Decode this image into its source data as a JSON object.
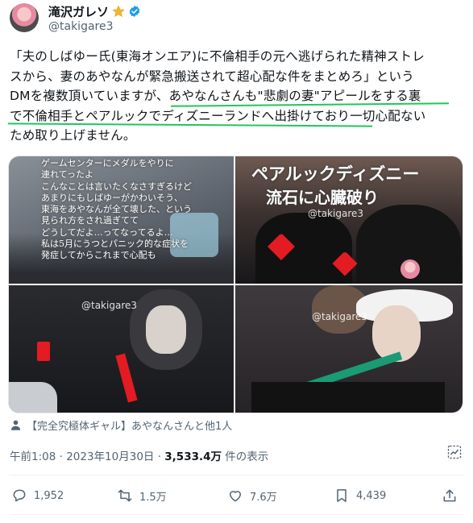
{
  "author": {
    "display_name": "滝沢ガレソ",
    "handle": "@takigare3",
    "emoji_badge": "star-emoji",
    "verified_badge": "verified-icon"
  },
  "tweet": {
    "line1": "「夫のしばゆー氏(東海オンエア)に不倫相手の元へ逃げられた精神ストレ",
    "line2": "スから、妻のあやなんが緊急搬送されて超心配な件をまとめろ」という",
    "line3": "DMを複数頂いていますが、あやなんさんも\"悲劇の妻\"アピールをする裏",
    "line4": "で不倫相手とペアルックでディズニーランドへ出掛けており一切心配ない",
    "line5": "ため取り上げません。"
  },
  "media": {
    "watermark": "@takigare3",
    "tile1_caption_lines": [
      "ゲームセンターにメダルをやりに",
      "連れてったよ",
      "こんなことは言いたくなさすぎるけど",
      "あまりにもしばゆーがかわいそう、",
      "東海をあやなんが全て壊した、という",
      "見られ方をされ過ぎてて",
      "どうしてだよ…ってなってるよ…",
      "私は5月にうつとパニック的な症状を",
      "発症してからこれまで心配も"
    ],
    "tile2_caption_line1": "ペアルックディズニー",
    "tile2_caption_line2": "流石に心臓破り"
  },
  "tag": {
    "text": "【完全究極体ギャル】あやなんさんと他1人"
  },
  "meta": {
    "time": "午前1:08 · 2023年10月30日 · ",
    "views_count": "3,533.4万",
    "views_label": " 件の表示"
  },
  "actions": {
    "reply_count": "1,952",
    "retweet_count": "1.5万",
    "like_count": "7.6万",
    "bookmark_count": "4,439"
  },
  "colors": {
    "highlight_underline": "#22c55e",
    "verified_blue": "#1d9bf0",
    "secondary_text": "#536471"
  }
}
